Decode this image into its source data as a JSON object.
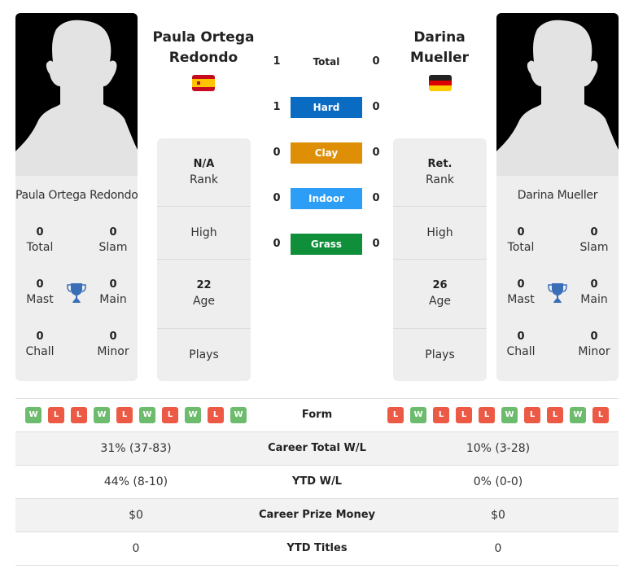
{
  "colors": {
    "hard": "#0a6bc2",
    "clay": "#de8f06",
    "indoor": "#2d9ef5",
    "grass": "#0f8f3a",
    "win": "#6dbb6d",
    "loss": "#ec5a45",
    "trophy": "#3a6fb8"
  },
  "player1": {
    "name_header": [
      "Paula Ortega",
      "Redondo"
    ],
    "card_name": "Paula Ortega Redondo",
    "flag_icon": "spain-flag-icon",
    "titles": {
      "total": {
        "value": "0",
        "label": "Total"
      },
      "slam": {
        "value": "0",
        "label": "Slam"
      },
      "mast": {
        "value": "0",
        "label": "Mast"
      },
      "main": {
        "value": "0",
        "label": "Main"
      },
      "chall": {
        "value": "0",
        "label": "Chall"
      },
      "minor": {
        "value": "0",
        "label": "Minor"
      }
    },
    "info": {
      "rank": {
        "value": "N/A",
        "label": "Rank"
      },
      "high": {
        "value": "",
        "label": "High"
      },
      "age": {
        "value": "22",
        "label": "Age"
      },
      "plays": {
        "value": "",
        "label": "Plays"
      }
    },
    "form": [
      "W",
      "L",
      "L",
      "W",
      "L",
      "W",
      "L",
      "W",
      "L",
      "W"
    ]
  },
  "player2": {
    "name_header": [
      "Darina",
      "Mueller"
    ],
    "card_name": "Darina Mueller",
    "flag_icon": "germany-flag-icon",
    "titles": {
      "total": {
        "value": "0",
        "label": "Total"
      },
      "slam": {
        "value": "0",
        "label": "Slam"
      },
      "mast": {
        "value": "0",
        "label": "Mast"
      },
      "main": {
        "value": "0",
        "label": "Main"
      },
      "chall": {
        "value": "0",
        "label": "Chall"
      },
      "minor": {
        "value": "0",
        "label": "Minor"
      }
    },
    "info": {
      "rank": {
        "value": "Ret.",
        "label": "Rank"
      },
      "high": {
        "value": "",
        "label": "High"
      },
      "age": {
        "value": "26",
        "label": "Age"
      },
      "plays": {
        "value": "",
        "label": "Plays"
      }
    },
    "form": [
      "L",
      "W",
      "L",
      "L",
      "L",
      "W",
      "L",
      "L",
      "W",
      "L"
    ]
  },
  "h2h": [
    {
      "label": "Total",
      "p1": "1",
      "p2": "0",
      "type": "total"
    },
    {
      "label": "Hard",
      "p1": "1",
      "p2": "0",
      "type": "hard"
    },
    {
      "label": "Clay",
      "p1": "0",
      "p2": "0",
      "type": "clay"
    },
    {
      "label": "Indoor",
      "p1": "0",
      "p2": "0",
      "type": "indoor"
    },
    {
      "label": "Grass",
      "p1": "0",
      "p2": "0",
      "type": "grass"
    }
  ],
  "stats": [
    {
      "label": "Form",
      "p1": "",
      "p2": ""
    },
    {
      "label": "Career Total W/L",
      "p1": "31% (37-83)",
      "p2": "10% (3-28)"
    },
    {
      "label": "YTD W/L",
      "p1": "44% (8-10)",
      "p2": "0% (0-0)"
    },
    {
      "label": "Career Prize Money",
      "p1": "$0",
      "p2": "$0"
    },
    {
      "label": "YTD Titles",
      "p1": "0",
      "p2": "0"
    }
  ]
}
